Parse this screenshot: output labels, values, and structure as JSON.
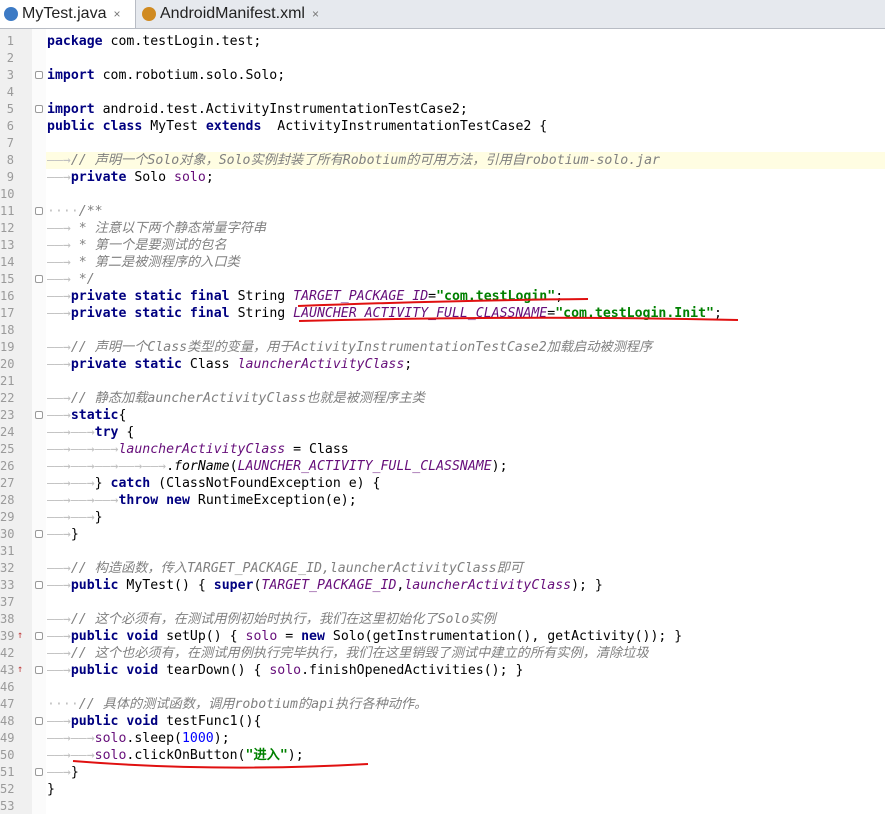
{
  "tabs": [
    {
      "label": "MyTest.java",
      "active": true,
      "icon": "java-class-icon",
      "color": "#3c7ac5"
    },
    {
      "label": "AndroidManifest.xml",
      "active": false,
      "icon": "xml-file-icon",
      "color": "#d08a20"
    }
  ],
  "tab_close_glyph": "×",
  "lines": [
    {
      "n": "1",
      "html": "<span class='kw'>package</span> com.testLogin.test;"
    },
    {
      "n": "2",
      "html": ""
    },
    {
      "n": "3",
      "html": "<span class='kw'>import</span> com.robotium.solo.Solo;",
      "fold": true
    },
    {
      "n": "4",
      "html": ""
    },
    {
      "n": "5",
      "html": "<span class='kw'>import</span> android.test.ActivityInstrumentationTestCase2;",
      "fold": true
    },
    {
      "n": "6",
      "html": "<span class='kw'>public class</span> MyTest <span class='kw'>extends</span>  ActivityInstrumentationTestCase2 {"
    },
    {
      "n": "7",
      "html": ""
    },
    {
      "n": "8",
      "html": "<span class='ws'>——→</span><span class='cm'>// 声明一个Solo对象，Solo实例封装了所有Robotium的可用方法，引用自robotium-solo.jar</span>",
      "hl": true
    },
    {
      "n": "9",
      "html": "<span class='ws'>——→</span><span class='kw'>private</span> Solo <span class='fldn'>solo</span>;"
    },
    {
      "n": "10",
      "html": ""
    },
    {
      "n": "11",
      "html": "<span class='ws'>····</span><span class='cm'>/**</span>",
      "fold": true
    },
    {
      "n": "12",
      "html": "<span class='ws'>——→</span><span class='cm'> * 注意以下两个静态常量字符串</span>"
    },
    {
      "n": "13",
      "html": "<span class='ws'>——→</span><span class='cm'> * 第一个是要测试的包名</span>"
    },
    {
      "n": "14",
      "html": "<span class='ws'>——→</span><span class='cm'> * 第二是被测程序的入口类</span>"
    },
    {
      "n": "15",
      "html": "<span class='ws'>——→</span><span class='cm'> */</span>",
      "fold": true
    },
    {
      "n": "16",
      "html": "<span class='ws'>——→</span><span class='kw'>private static final</span> String <span class='fld'>TARGET_PACKAGE_ID</span>=<span class='str'>\"com.testLogin\"</span>;"
    },
    {
      "n": "17",
      "html": "<span class='ws'>——→</span><span class='kw'>private static final</span> String <span class='fld'>LAUNCHER_ACTIVITY_FULL_CLASSNAME</span>=<span class='str'>\"com.testLogin.Init\"</span>;"
    },
    {
      "n": "18",
      "html": ""
    },
    {
      "n": "19",
      "html": "<span class='ws'>——→</span><span class='cm'>// 声明一个Class类型的变量，用于ActivityInstrumentationTestCase2加载启动被测程序</span>"
    },
    {
      "n": "20",
      "html": "<span class='ws'>——→</span><span class='kw'>private static</span> Class <span class='fld'>launcherActivityClass</span>;"
    },
    {
      "n": "21",
      "html": ""
    },
    {
      "n": "22",
      "html": "<span class='ws'>——→</span><span class='cm'>// 静态加载auncherActivityClass也就是被测程序主类</span>"
    },
    {
      "n": "23",
      "html": "<span class='ws'>——→</span><span class='kw'>static</span>{",
      "fold": true
    },
    {
      "n": "24",
      "html": "<span class='ws'>——→——→</span><span class='kw'>try</span> {"
    },
    {
      "n": "25",
      "html": "<span class='ws'>——→——→——→</span><span class='fld'>launcherActivityClass</span> = Class"
    },
    {
      "n": "26",
      "html": "<span class='ws'>——→——→——→——→——→</span>.<span class='cm' style='color:#000'>forName</span>(<span class='fld'>LAUNCHER_ACTIVITY_FULL_CLASSNAME</span>);"
    },
    {
      "n": "27",
      "html": "<span class='ws'>——→——→</span>} <span class='kw'>catch</span> (ClassNotFoundException e) {"
    },
    {
      "n": "28",
      "html": "<span class='ws'>——→——→——→</span><span class='kw'>throw new</span> RuntimeException(e);"
    },
    {
      "n": "29",
      "html": "<span class='ws'>——→——→</span>}"
    },
    {
      "n": "30",
      "html": "<span class='ws'>——→</span>}",
      "fold": true
    },
    {
      "n": "31",
      "html": ""
    },
    {
      "n": "32",
      "html": "<span class='ws'>——→</span><span class='cm'>// 构造函数，传入TARGET_PACKAGE_ID,launcherActivityClass即可</span>"
    },
    {
      "n": "33",
      "html": "<span class='ws'>——→</span><span class='kw'>public</span> MyTest() { <span class='kw'>super</span>(<span class='fld'>TARGET_PACKAGE_ID</span>,<span class='fld'>launcherActivityClass</span>); }",
      "foldplus": true
    },
    {
      "n": "37",
      "html": ""
    },
    {
      "n": "38",
      "html": "<span class='ws'>——→</span><span class='cm'>// 这个必须有，在测试用例初始时执行，我们在这里初始化了Solo实例</span>"
    },
    {
      "n": "39",
      "html": "<span class='ws'>——→</span><span class='kw'>public void</span> setUp() { <span class='fldn'>solo</span> = <span class='kw'>new</span> Solo(getInstrumentation(), getActivity()); }",
      "foldplus": true,
      "override": true
    },
    {
      "n": "42",
      "html": "<span class='ws'>——→</span><span class='cm'>// 这个也必须有，在测试用例执行完毕执行，我们在这里销毁了测试中建立的所有实例，清除垃圾</span>"
    },
    {
      "n": "43",
      "html": "<span class='ws'>——→</span><span class='kw'>public void</span> tearDown() { <span class='fldn'>solo</span>.finishOpenedActivities(); }",
      "foldplus": true,
      "override": true
    },
    {
      "n": "46",
      "html": ""
    },
    {
      "n": "47",
      "html": "<span class='ws'>····</span><span class='cm'>// 具体的测试函数，调用robotium的api执行各种动作。</span>"
    },
    {
      "n": "48",
      "html": "<span class='ws'>——→</span><span class='kw'>public void</span> testFunc1(){",
      "fold": true
    },
    {
      "n": "49",
      "html": "<span class='ws'>——→——→</span><span class='fldn'>solo</span>.sleep(<span class='num'>1000</span>);"
    },
    {
      "n": "50",
      "html": "<span class='ws'>——→——→</span><span class='fldn'>solo</span>.clickOnButton(<span class='str'>\"进入\"</span>);"
    },
    {
      "n": "51",
      "html": "<span class='ws'>——→</span>}",
      "fold": true
    },
    {
      "n": "52",
      "html": "}"
    },
    {
      "n": "53",
      "html": ""
    }
  ]
}
